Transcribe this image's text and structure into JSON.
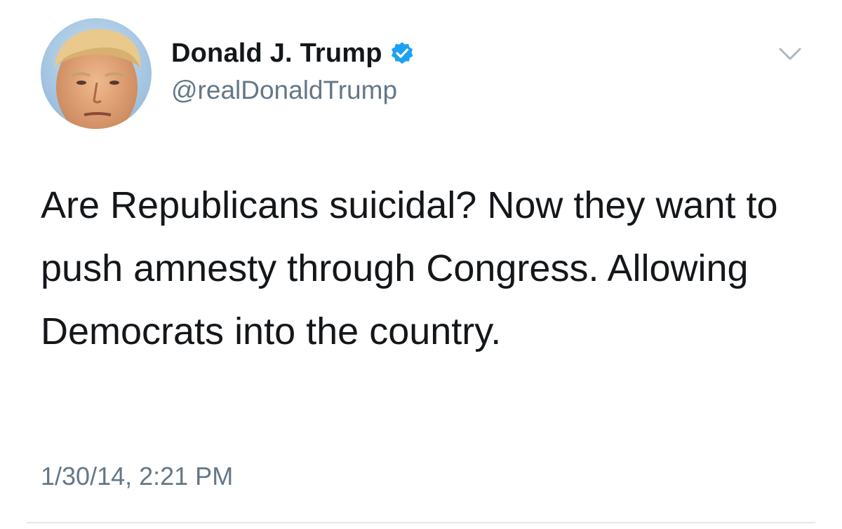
{
  "tweet": {
    "author": {
      "display_name": "Donald J. Trump",
      "handle": "@realDonaldTrump",
      "verified": true,
      "avatar_icon": "profile-photo"
    },
    "text": "Are Republicans suicidal? Now they want to push amnesty through Congress. Allowing Democrats into the country.",
    "timestamp": "1/30/14, 2:21 PM",
    "menu_icon": "chevron-down-icon"
  },
  "colors": {
    "text_primary": "#14171a",
    "text_secondary": "#657786",
    "verified_blue": "#1da1f2",
    "divider": "#e1e8ed",
    "chevron": "#aab8c2"
  }
}
